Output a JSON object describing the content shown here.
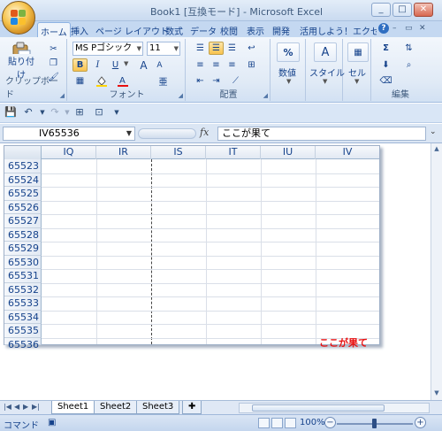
{
  "window": {
    "title": "Book1  [互換モード] - Microsoft Excel",
    "min_label": "_",
    "max_label": "□",
    "close_label": "✕"
  },
  "ribbon_tabs": [
    "ホーム",
    "挿入",
    "ページ レイアウト",
    "数式",
    "データ",
    "校閲",
    "表示",
    "開発",
    "活用しよう！エクセル"
  ],
  "ribbon": {
    "clipboard": {
      "paste_label": "貼り付け",
      "group_label": "クリップボード"
    },
    "font": {
      "font_name": "MS Pゴシック",
      "font_size": "11",
      "bold": "B",
      "italic": "I",
      "underline": "U",
      "grow": "A",
      "shrink": "A",
      "group_label": "フォント"
    },
    "alignment": {
      "group_label": "配置"
    },
    "number": {
      "label": "数値",
      "symbol": "%"
    },
    "styles": {
      "label": "スタイル"
    },
    "cells": {
      "label": "セル"
    },
    "editing": {
      "sigma": "Σ",
      "group_label": "編集"
    }
  },
  "formula_bar": {
    "name_box": "IV65536",
    "fx": "fx",
    "formula": "ここが果て"
  },
  "grid": {
    "columns": [
      "IQ",
      "IR",
      "IS",
      "IT",
      "IU",
      "IV"
    ],
    "rows": [
      "65523",
      "65524",
      "65525",
      "65526",
      "65527",
      "65528",
      "65529",
      "65530",
      "65531",
      "65532",
      "65533",
      "65534",
      "65535",
      "65536"
    ],
    "cell_text": "ここが果て"
  },
  "sheet_tabs": [
    "Sheet1",
    "Sheet2",
    "Sheet3"
  ],
  "status": {
    "mode": "コマンド",
    "zoom": "100%"
  },
  "colors": {
    "accent": "#15428b",
    "cell_text": "#e81010",
    "ribbon_bg": "#dfe9f5"
  }
}
